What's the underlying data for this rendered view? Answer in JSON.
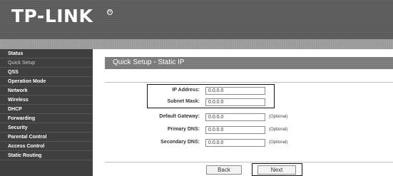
{
  "brand": {
    "logo": "TP-LINK",
    "registered": "R"
  },
  "sidebar": {
    "items": [
      {
        "label": "Status"
      },
      {
        "label": "Quick Setup"
      },
      {
        "label": "QSS"
      },
      {
        "label": "Operation Mode"
      },
      {
        "label": "Network"
      },
      {
        "label": "Wireless"
      },
      {
        "label": "DHCP"
      },
      {
        "label": "Forwarding"
      },
      {
        "label": "Security"
      },
      {
        "label": "Parental Control"
      },
      {
        "label": "Access Control"
      },
      {
        "label": "Static Routing"
      }
    ],
    "active_index": 1
  },
  "main": {
    "title": "Quick Setup - Static IP",
    "fields": [
      {
        "label": "IP Address:",
        "value": "0.0.0.0",
        "note": ""
      },
      {
        "label": "Subnet Mask:",
        "value": "0.0.0.0",
        "note": ""
      },
      {
        "label": "Default Gateway:",
        "value": "0.0.0.0",
        "note": "(Optional)"
      },
      {
        "label": "Primary DNS:",
        "value": "0.0.0.0",
        "note": "(Optional)"
      },
      {
        "label": "Secondary DNS:",
        "value": "0.0.0.0",
        "note": "(Optional)"
      }
    ],
    "buttons": {
      "back": "Back",
      "next": "Next"
    }
  },
  "colors": {
    "header_bg": "#5b5b5b",
    "sidebar_bg": "#3f3f3f",
    "title_bar_bg": "#7a7a7a",
    "highlight_border": "#111111"
  }
}
